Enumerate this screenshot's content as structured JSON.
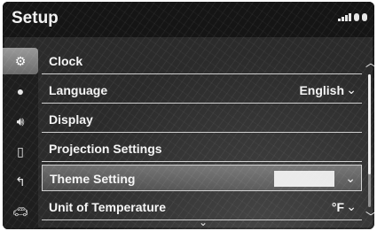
{
  "header": {
    "title": "Setup"
  },
  "sidebar": {
    "icons": [
      {
        "name": "settings-icon",
        "active": true
      },
      {
        "name": "info-icon",
        "active": false
      },
      {
        "name": "speaker-icon",
        "active": false
      },
      {
        "name": "phone-icon",
        "active": false
      },
      {
        "name": "navigation-icon",
        "active": false
      },
      {
        "name": "car-icon",
        "active": false
      }
    ]
  },
  "list": {
    "items": [
      {
        "label": "Clock",
        "value": "",
        "chevron": false
      },
      {
        "label": "Language",
        "value": "English",
        "chevron": true
      },
      {
        "label": "Display",
        "value": "",
        "chevron": false
      },
      {
        "label": "Projection Settings",
        "value": "",
        "chevron": false
      },
      {
        "label": "Theme Setting",
        "value": "",
        "chevron": true,
        "active": true
      },
      {
        "label": "Unit of Temperature",
        "value": "°F",
        "chevron": true
      }
    ]
  },
  "scroll": {
    "position_fraction": 0.0,
    "visible_fraction": 0.75
  },
  "colors": {
    "background": "#2b2b2b",
    "header": "#151515",
    "text": "#f5f5f5",
    "divider": "#cfcfcf"
  }
}
